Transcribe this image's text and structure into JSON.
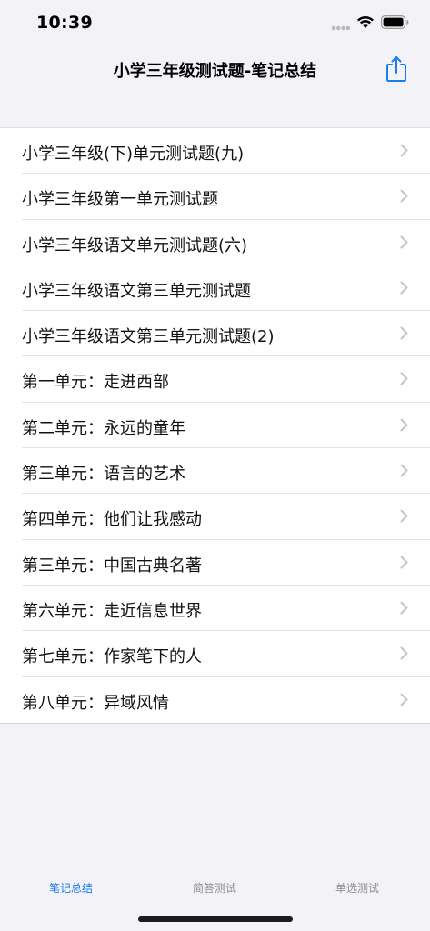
{
  "status_bar": {
    "time": "10:39"
  },
  "nav": {
    "title": "小学三年级测试题-笔记总结"
  },
  "colors": {
    "accent": "#1a7cf4",
    "background": "#f2f2f7",
    "chevron": "#c4c4c8",
    "inactive_tab": "#8e8e93"
  },
  "list": {
    "items": [
      {
        "label": "小学三年级(下)单元测试题(九)"
      },
      {
        "label": "小学三年级第一单元测试题"
      },
      {
        "label": "小学三年级语文单元测试题(六)"
      },
      {
        "label": "小学三年级语文第三单元测试题"
      },
      {
        "label": "小学三年级语文第三单元测试题(2)"
      },
      {
        "label": "第一单元：走进西部"
      },
      {
        "label": "第二单元：永远的童年"
      },
      {
        "label": "第三单元：语言的艺术"
      },
      {
        "label": "第四单元：他们让我感动"
      },
      {
        "label": "第三单元：中国古典名著"
      },
      {
        "label": "第六单元：走近信息世界"
      },
      {
        "label": "第七单元：作家笔下的人"
      },
      {
        "label": "第八单元：异域风情"
      }
    ]
  },
  "tab_bar": {
    "tabs": [
      {
        "label": "笔记总结",
        "active": true
      },
      {
        "label": "简答测试",
        "active": false
      },
      {
        "label": "单选测试",
        "active": false
      }
    ]
  }
}
